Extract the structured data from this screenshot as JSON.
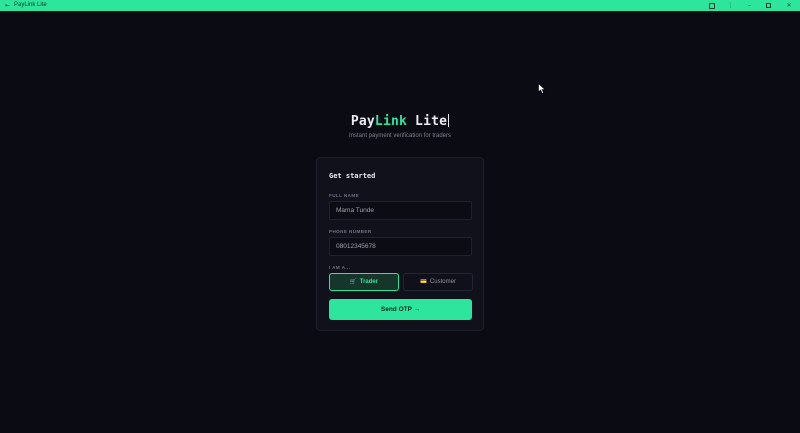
{
  "window": {
    "title": "PayLink Lite",
    "back_glyph": "←"
  },
  "brand": {
    "part1": "Pay",
    "part2": "Link",
    "part3": " Lite",
    "tagline": "Instant payment verification for traders"
  },
  "form": {
    "title": "Get started",
    "full_name_label": "FULL NAME",
    "full_name_value": "Mama Tunde",
    "phone_label": "PHONE NUMBER",
    "phone_value": "08012345678",
    "role_label": "I AM A...",
    "roles": [
      {
        "emoji": "🛒",
        "label": "Trader",
        "selected": true
      },
      {
        "emoji": "💳",
        "label": "Customer",
        "selected": false
      }
    ],
    "submit_label": "Send OTP →"
  },
  "colors": {
    "accent": "#2ee59d",
    "background": "#0b0c13",
    "card": "#10111b"
  }
}
